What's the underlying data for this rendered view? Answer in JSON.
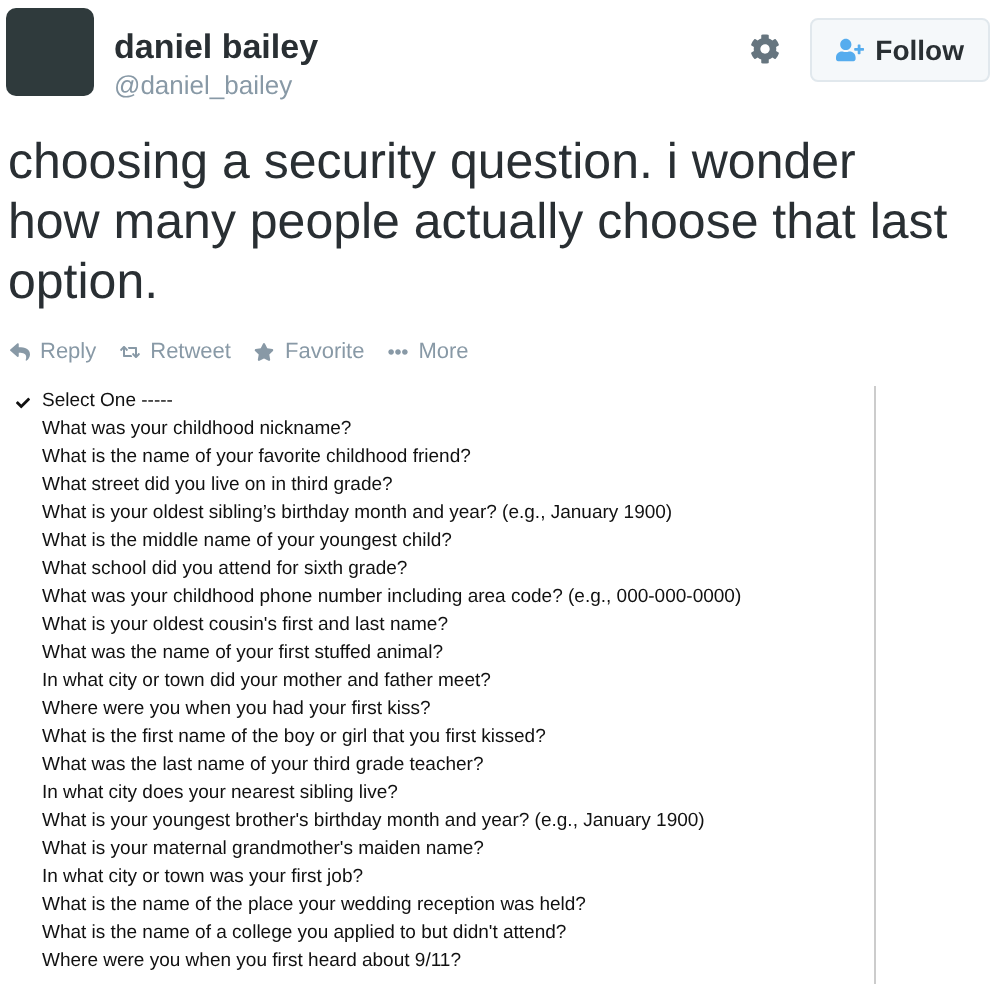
{
  "user": {
    "name": "daniel bailey",
    "handle": "@daniel_bailey"
  },
  "follow_button": {
    "label": "Follow"
  },
  "tweet_text": "choosing a security question. i wonder how many people actually choose that last option.",
  "actions": [
    {
      "kind": "reply",
      "label": "Reply"
    },
    {
      "kind": "retweet",
      "label": "Retweet"
    },
    {
      "kind": "favorite",
      "label": "Favorite"
    },
    {
      "kind": "more",
      "label": "More"
    }
  ],
  "dropdown": {
    "options": [
      {
        "label": "Select One -----",
        "selected": true
      },
      {
        "label": "What was your childhood nickname?",
        "selected": false
      },
      {
        "label": "What is the name of your favorite childhood friend?",
        "selected": false
      },
      {
        "label": "What street did you live on in third grade?",
        "selected": false
      },
      {
        "label": "What is your oldest sibling’s birthday month and year? (e.g., January 1900)",
        "selected": false
      },
      {
        "label": "What is the middle name of your youngest child?",
        "selected": false
      },
      {
        "label": "What school did you attend for sixth grade?",
        "selected": false
      },
      {
        "label": "What was your childhood phone number including area code? (e.g., 000-000-0000)",
        "selected": false
      },
      {
        "label": "What is your oldest cousin's first and last name?",
        "selected": false
      },
      {
        "label": "What was the name of your first stuffed animal?",
        "selected": false
      },
      {
        "label": "In what city or town did your mother and father meet?",
        "selected": false
      },
      {
        "label": "Where were you when you had your first kiss?",
        "selected": false
      },
      {
        "label": "What is the first name of the boy or girl that you first kissed?",
        "selected": false
      },
      {
        "label": "What was the last name of your third grade teacher?",
        "selected": false
      },
      {
        "label": "In what city does your nearest sibling live?",
        "selected": false
      },
      {
        "label": "What is your youngest brother's birthday month and year? (e.g., January 1900)",
        "selected": false
      },
      {
        "label": "What is your maternal grandmother's maiden name?",
        "selected": false
      },
      {
        "label": "In what city or town was your first job?",
        "selected": false
      },
      {
        "label": "What is the name of the place your wedding reception was held?",
        "selected": false
      },
      {
        "label": "What is the name of a college you applied to but didn't attend?",
        "selected": false
      },
      {
        "label": "Where were you when you first heard about 9/11?",
        "selected": false
      }
    ]
  }
}
